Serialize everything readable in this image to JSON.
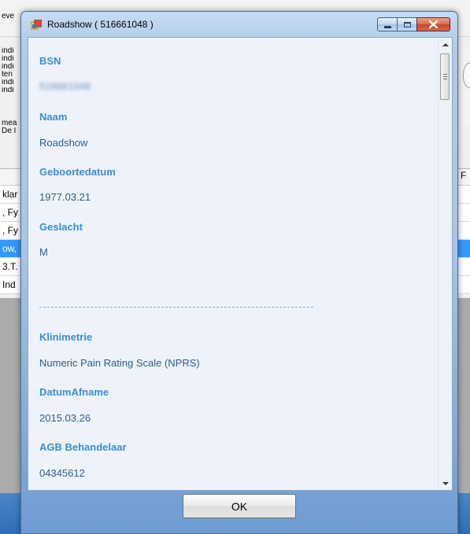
{
  "window": {
    "title": "Roadshow ( 516661048 )"
  },
  "fields": [
    {
      "label": "BSN",
      "value": "516661048"
    },
    {
      "label": "Naam",
      "value": "Roadshow"
    },
    {
      "label": "Geboortedatum",
      "value": "1977.03.21"
    },
    {
      "label": "Geslacht",
      "value": "M"
    },
    {
      "label": "Klinimetrie",
      "value": "Numeric Pain Rating Scale (NPRS)"
    },
    {
      "label": "DatumAfname",
      "value": "2015.03.26"
    },
    {
      "label": "AGB Behandelaar",
      "value": "04345612"
    }
  ],
  "ok_label": "OK",
  "background": {
    "top_text": "eve",
    "lines": [
      "indi",
      "indi",
      "indi",
      "ten",
      "indi",
      "indi"
    ],
    "lines2": [
      "mea",
      "De I"
    ],
    "grid_header_right": "F",
    "rows": [
      {
        "text": "klar",
        "selected": false
      },
      {
        "text": ", Fy",
        "selected": false
      },
      {
        "text": ", Fy",
        "selected": false
      },
      {
        "text": "ow,",
        "selected": true
      },
      {
        "text": "3.T.",
        "selected": false
      },
      {
        "text": "Ind",
        "selected": false
      }
    ]
  },
  "colors": {
    "label": "#3a8ed3",
    "value": "#2f5c8a",
    "selection": "#3399ff"
  }
}
